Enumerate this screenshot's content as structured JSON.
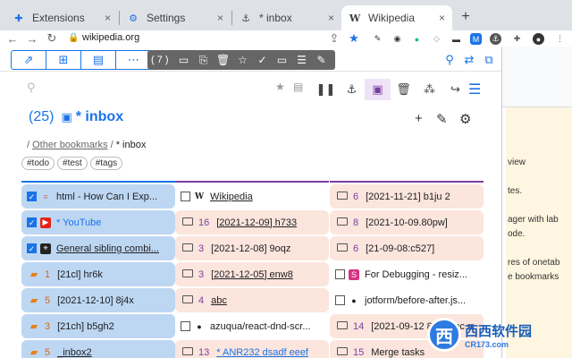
{
  "browser": {
    "tabs": [
      {
        "title": "Extensions",
        "icon": "puzzle-icon"
      },
      {
        "title": "Settings",
        "icon": "gear-icon"
      },
      {
        "title": "* inbox",
        "icon": "inbox-icon"
      },
      {
        "title": "Wikipedia",
        "icon": "wikipedia-icon"
      }
    ],
    "new_tab": "+",
    "url": "wikipedia.org",
    "tab_close": "×"
  },
  "popup": {
    "selection_count": "( 7 )",
    "title_count": "(25)",
    "title_text": "* inbox",
    "breadcrumb": {
      "sep": "/",
      "parent": "Other bookmarks",
      "current": "* inbox"
    },
    "tags": [
      "#todo",
      "#test",
      "#tags"
    ]
  },
  "columns": [
    [
      {
        "kind": "check",
        "checked": true,
        "fav": "doc",
        "label": "html - How Can I Exp...",
        "style": "blue"
      },
      {
        "kind": "check",
        "checked": true,
        "fav": "youtube",
        "label": "* YouTube",
        "style": "blue",
        "color": "blue"
      },
      {
        "kind": "check",
        "checked": true,
        "fav": "pin",
        "label": "General sibling combi...",
        "style": "blue",
        "underline": true
      },
      {
        "kind": "folder",
        "num": "1",
        "label": "[21cl] hr6k",
        "style": "blue"
      },
      {
        "kind": "folder",
        "num": "5",
        "label": "[2021-12-10] 8j4x",
        "style": "blue"
      },
      {
        "kind": "folder",
        "num": "3",
        "label": "[21ch] b5gh2",
        "style": "blue"
      },
      {
        "kind": "folder",
        "num": "5",
        "label": "_inbox2",
        "style": "blue",
        "underline": true
      }
    ],
    [
      {
        "kind": "check",
        "checked": false,
        "fav": "wiki",
        "label": "Wikipedia",
        "style": "plain",
        "underline": true
      },
      {
        "kind": "folder",
        "num": "16",
        "label": "[2021-12-09] h733",
        "style": "peach",
        "underline": true
      },
      {
        "kind": "folder",
        "num": "3",
        "label": "[2021-12-08] 9oqz",
        "style": "peach"
      },
      {
        "kind": "folder",
        "num": "3",
        "label": "[2021-12-05] enw8",
        "style": "peach",
        "underline": true
      },
      {
        "kind": "folder",
        "num": "4",
        "label": "abc",
        "style": "peach",
        "underline": true
      },
      {
        "kind": "check",
        "checked": false,
        "fav": "github",
        "label": "azuqua/react-dnd-scr...",
        "style": "plain"
      },
      {
        "kind": "folder",
        "num": "13",
        "label": "* ANR232 dsadf eeef",
        "style": "peach",
        "underline": true,
        "color": "blue"
      }
    ],
    [
      {
        "kind": "folder",
        "num": "6",
        "label": "[2021-11-21] b1ju 2",
        "style": "peach"
      },
      {
        "kind": "folder",
        "num": "8",
        "label": "[2021-10-09.80pw]",
        "style": "peach"
      },
      {
        "kind": "folder",
        "num": "6",
        "label": "[21-09-08:c527]",
        "style": "peach"
      },
      {
        "kind": "check",
        "checked": false,
        "fav": "s",
        "label": "For Debugging - resiz...",
        "style": "plain"
      },
      {
        "kind": "check",
        "checked": false,
        "fav": "github",
        "label": "jotform/before-after.js...",
        "style": "plain"
      },
      {
        "kind": "folder",
        "num": "14",
        "label": "[2021-09-12 8jqr] abc rr",
        "style": "peach"
      },
      {
        "kind": "folder",
        "num": "15",
        "label": "Merge tasks",
        "style": "peach"
      }
    ]
  ],
  "behind_page": {
    "lines": [
      "view",
      "tes.",
      "ager with lab",
      "ode.",
      "res of onetab",
      "e bookmarks"
    ]
  },
  "watermark": {
    "logo": "西",
    "name": "西西软件园",
    "domain": "CR173.com"
  }
}
